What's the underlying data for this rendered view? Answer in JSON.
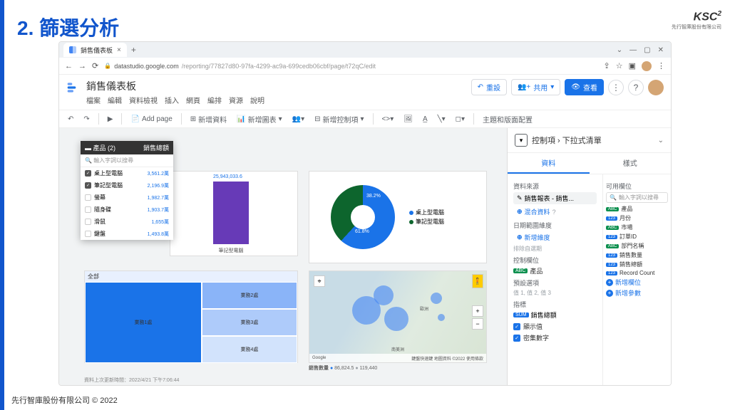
{
  "slide": {
    "title": "2. 篩選分析"
  },
  "ksc": {
    "label": "KSC",
    "sup": "2",
    "sub": "先行智庫股份有限公司"
  },
  "browser": {
    "tab": "銷售儀表板",
    "url_host": "datastudio.google.com",
    "url_path": "/reporting/77827d80-97fa-4299-ac9a-699cedb06cbf/page/t72qC/edit"
  },
  "app": {
    "title": "銷售儀表板",
    "menus": [
      "檔案",
      "編輯",
      "資料檢視",
      "插入",
      "網頁",
      "編排",
      "資源",
      "說明"
    ],
    "reset": "重設",
    "share": "共用",
    "view": "查看"
  },
  "toolbar": {
    "addpage": "Add page",
    "adddata": "新增資料",
    "addchart": "新增圖表",
    "addcontrol": "新增控制項",
    "theme": "主題和版面配置"
  },
  "filter": {
    "header_left": "產品 (2)",
    "header_right": "銷售總額",
    "search": "輸入字詞以搜尋",
    "items": [
      {
        "label": "桌上型電腦",
        "val": "3,561.2萬",
        "checked": true
      },
      {
        "label": "筆記型電腦",
        "val": "2,196.9萬",
        "checked": true
      },
      {
        "label": "螢幕",
        "val": "1,982.7萬",
        "checked": false
      },
      {
        "label": "隨身碟",
        "val": "1,903.7萬",
        "checked": false
      },
      {
        "label": "滑鼠",
        "val": "1,655萬",
        "checked": false
      },
      {
        "label": "鍵盤",
        "val": "1,493.8萬",
        "checked": false
      }
    ]
  },
  "datacard": {
    "label": "銷售總額",
    "value": "25,943,033.6"
  },
  "chart_data": {
    "type": "bar",
    "categories": [
      "筆記型電腦"
    ],
    "values": [
      25943033.6
    ],
    "title": "",
    "xlabel": "",
    "ylabel": ""
  },
  "donut": {
    "series": [
      {
        "name": "桌上型電腦",
        "value": 61.8,
        "color": "#1a73e8"
      },
      {
        "name": "筆記型電腦",
        "value": 38.2,
        "color": "#0d652d"
      }
    ]
  },
  "treemap": {
    "header": "全部",
    "cells": [
      "業務1處",
      "業務2處",
      "業務3處",
      "業務1處",
      "業務4處"
    ]
  },
  "map": {
    "google": "Google",
    "shortcut": "鍵盤快速鍵",
    "credit": "地圖資料 ©2022",
    "terms": "使用條款",
    "region": "南美洲",
    "eu": "歐洲",
    "stats_label": "銷售數量",
    "stats_a": "86,824.5",
    "stats_b": "119,440"
  },
  "panel": {
    "title": "控制項 › 下拉式清單",
    "tabs": [
      "資料",
      "樣式"
    ],
    "datasource_label": "資料來源",
    "datasource": "銷售報表 - 銷售...",
    "blend": "混合資料",
    "daterange_label": "日期範圍維度",
    "adddim": "新增維度",
    "control_label": "控制欄位",
    "control_field": "產品",
    "preselect": "預設選項",
    "preselect_hint": "值 1, 值 2, 值 3",
    "metric_label": "指標",
    "metric": "銷售總額",
    "showval": "顯示值",
    "compact": "密集數字",
    "avail_label": "可用欄位",
    "search": "輸入字詞以搜尋",
    "fields": [
      {
        "tag": "ABC",
        "type": "abc",
        "name": "產品"
      },
      {
        "tag": "123",
        "type": "123",
        "name": "月份"
      },
      {
        "tag": "ABC",
        "type": "abc",
        "name": "市場"
      },
      {
        "tag": "123",
        "type": "123",
        "name": "訂單ID"
      },
      {
        "tag": "ABC",
        "type": "abc",
        "name": "部門名稱"
      },
      {
        "tag": "123",
        "type": "123",
        "name": "銷售數量"
      },
      {
        "tag": "123",
        "type": "123",
        "name": "銷售總額"
      },
      {
        "tag": "123",
        "type": "123",
        "name": "Record Count"
      }
    ],
    "addfield": "新增欄位",
    "addparam": "新增參數"
  },
  "status": "資料上次更新時間：2022/4/21 下午7:06:44",
  "copyright": "先行智庫股份有限公司 © 2022"
}
